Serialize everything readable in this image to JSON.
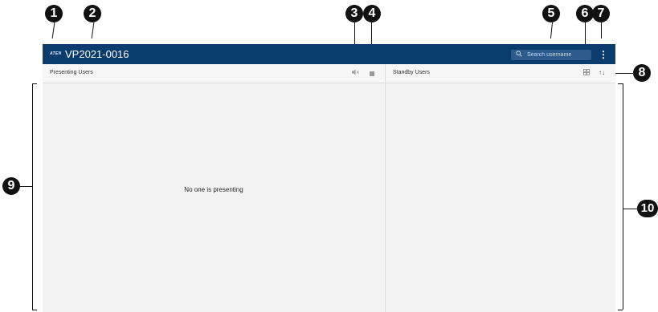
{
  "callouts": [
    "1",
    "2",
    "3",
    "4",
    "5",
    "6",
    "7",
    "8",
    "9",
    "10"
  ],
  "header": {
    "logo": "ATEN",
    "title": "VP2021-0016",
    "search_placeholder": "Search username",
    "search_icon": "search-icon",
    "menu_icon": "more-vertical-icon",
    "menu_glyph": "⋮"
  },
  "presenting": {
    "title": "Presenting Users",
    "mute_icon": "mute-icon",
    "mute_glyph": "🔈",
    "stop_icon": "stop-icon",
    "empty_message": "No one is presenting"
  },
  "standby": {
    "title": "Standby Users",
    "layout_icon": "grid-view-icon",
    "layout_glyph": "▦",
    "sort_icon": "sort-icon",
    "sort_glyph": "↑↓"
  },
  "colors": {
    "topbar": "#0b3c6e",
    "panel": "#f3f3f3",
    "callout": "#111111"
  }
}
